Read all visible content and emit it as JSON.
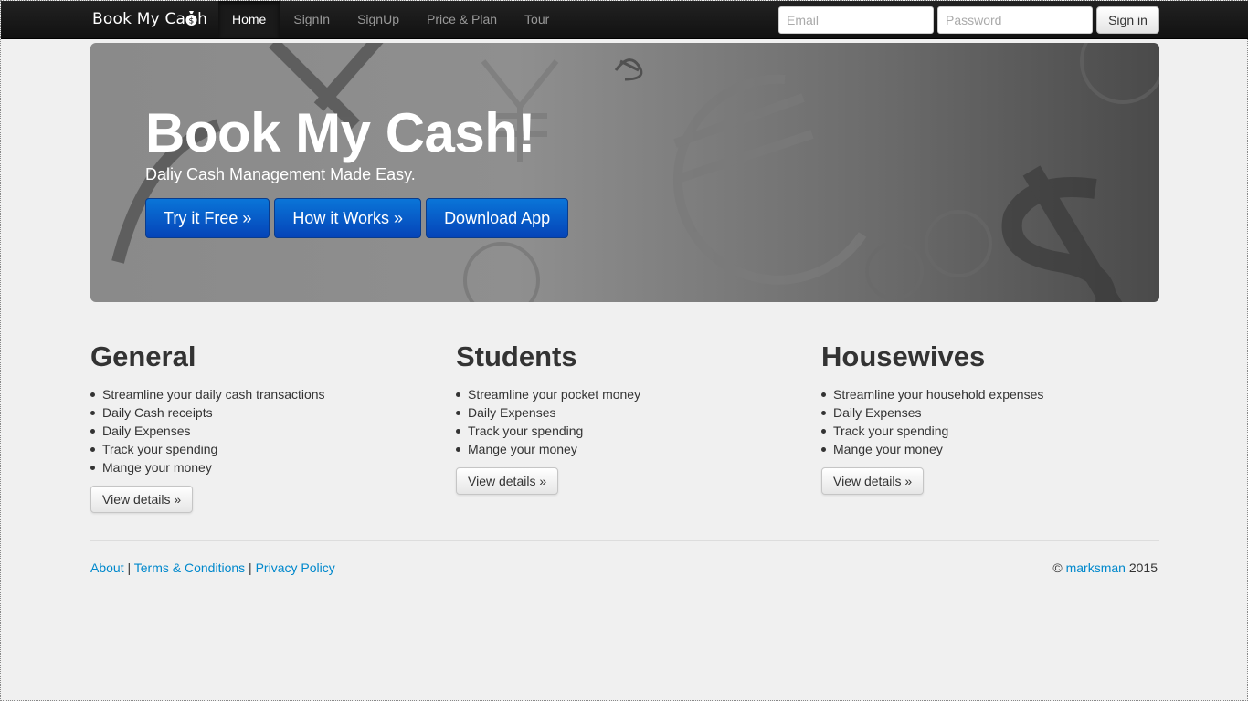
{
  "navbar": {
    "brand": "Book My Ca",
    "brand_tail": "h",
    "items": [
      {
        "label": "Home"
      },
      {
        "label": "SignIn"
      },
      {
        "label": "SignUp"
      },
      {
        "label": "Price & Plan"
      },
      {
        "label": "Tour"
      }
    ],
    "email_placeholder": "Email",
    "password_placeholder": "Password",
    "signin_label": "Sign in"
  },
  "hero": {
    "title": "Book My Cash!",
    "subtitle": "Daliy Cash Management Made Easy.",
    "buttons": [
      {
        "label": "Try it Free »"
      },
      {
        "label": "How it Works »"
      },
      {
        "label": "Download App"
      }
    ]
  },
  "columns": [
    {
      "heading": "General",
      "items": [
        "Streamline your daily cash transactions",
        "Daily Cash receipts",
        "Daily Expenses",
        "Track your spending",
        "Mange your money"
      ],
      "button": "View details »"
    },
    {
      "heading": "Students",
      "items": [
        "Streamline your pocket money",
        "Daily Expenses",
        "Track your spending",
        "Mange your money"
      ],
      "button": "View details »"
    },
    {
      "heading": "Housewives",
      "items": [
        "Streamline your household expenses",
        "Daily Expenses",
        "Track your spending",
        "Mange your money"
      ],
      "button": "View details »"
    }
  ],
  "footer": {
    "links": [
      "About",
      "Terms & Conditions",
      "Privacy Policy"
    ],
    "separator": " | ",
    "copyright_symbol": "©",
    "author": "marksman",
    "year": "2015"
  },
  "colors": {
    "navbar": "#111111",
    "hero_button": "#0a6fd6",
    "link": "#0088cc"
  }
}
